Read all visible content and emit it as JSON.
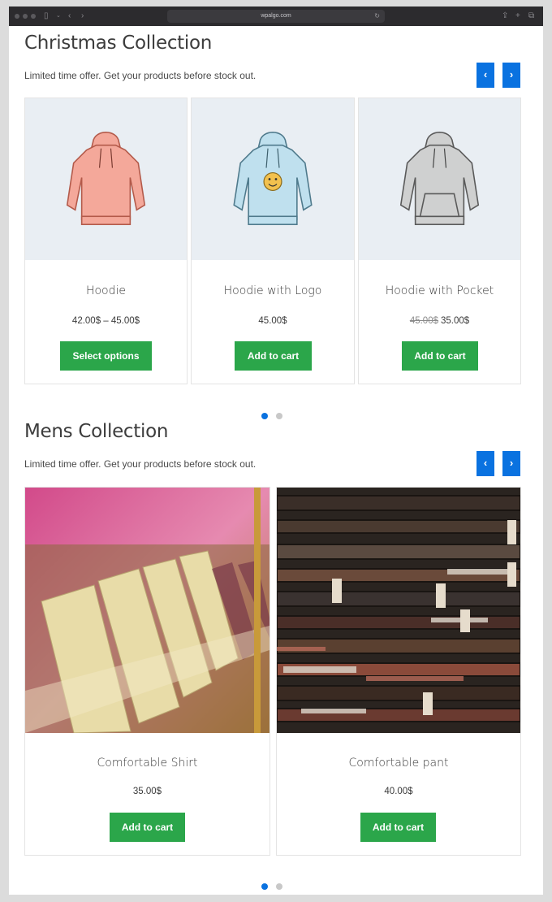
{
  "browser": {
    "url": "wpalgo.com"
  },
  "christmas": {
    "title": "Christmas Collection",
    "subtitle": "Limited time offer. Get your products before stock out.",
    "prev_label": "‹",
    "next_label": "›",
    "products": [
      {
        "name": "Hoodie",
        "price": "42.00$ – 45.00$",
        "button": "Select options",
        "color": "#f4a89a",
        "icon": "pink-hoodie-icon"
      },
      {
        "name": "Hoodie with Logo",
        "price": "45.00$",
        "button": "Add to cart",
        "color": "#bfe0ee",
        "icon": "blue-hoodie-logo-icon"
      },
      {
        "name": "Hoodie with Pocket",
        "price_old": "45.00$",
        "price": "35.00$",
        "button": "Add to cart",
        "color": "#cfd0d0",
        "icon": "gray-hoodie-pocket-icon"
      }
    ]
  },
  "mens": {
    "title": "Mens Collection",
    "subtitle": "Limited time offer. Get your products before stock out.",
    "prev_label": "‹",
    "next_label": "›",
    "products": [
      {
        "name": "Comfortable Shirt",
        "price": "35.00$",
        "button": "Add to cart",
        "icon": "shirt-display-photo"
      },
      {
        "name": "Comfortable pant",
        "price": "40.00$",
        "button": "Add to cart",
        "icon": "pants-stack-photo"
      }
    ]
  },
  "colors": {
    "accent": "#0a72e0",
    "button_green": "#2ba64a"
  }
}
